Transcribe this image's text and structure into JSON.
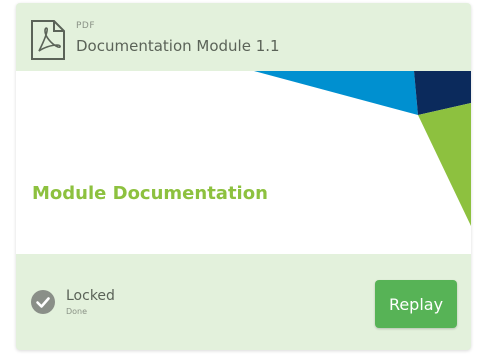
{
  "card": {
    "file_type": "PDF",
    "title": "Documentation Module 1.1",
    "thumbnail_title": "Module Documentation",
    "status_label": "Locked",
    "status_sub": "Done",
    "replay_label": "Replay",
    "icons": {
      "file": "pdf-file-icon",
      "status": "check-circle-icon"
    },
    "colors": {
      "card_bg": "#e3f1dc",
      "accent_green": "#8dc13f",
      "button_green": "#57b356",
      "blue": "#0090d0",
      "navy": "#0b2a5c"
    }
  }
}
